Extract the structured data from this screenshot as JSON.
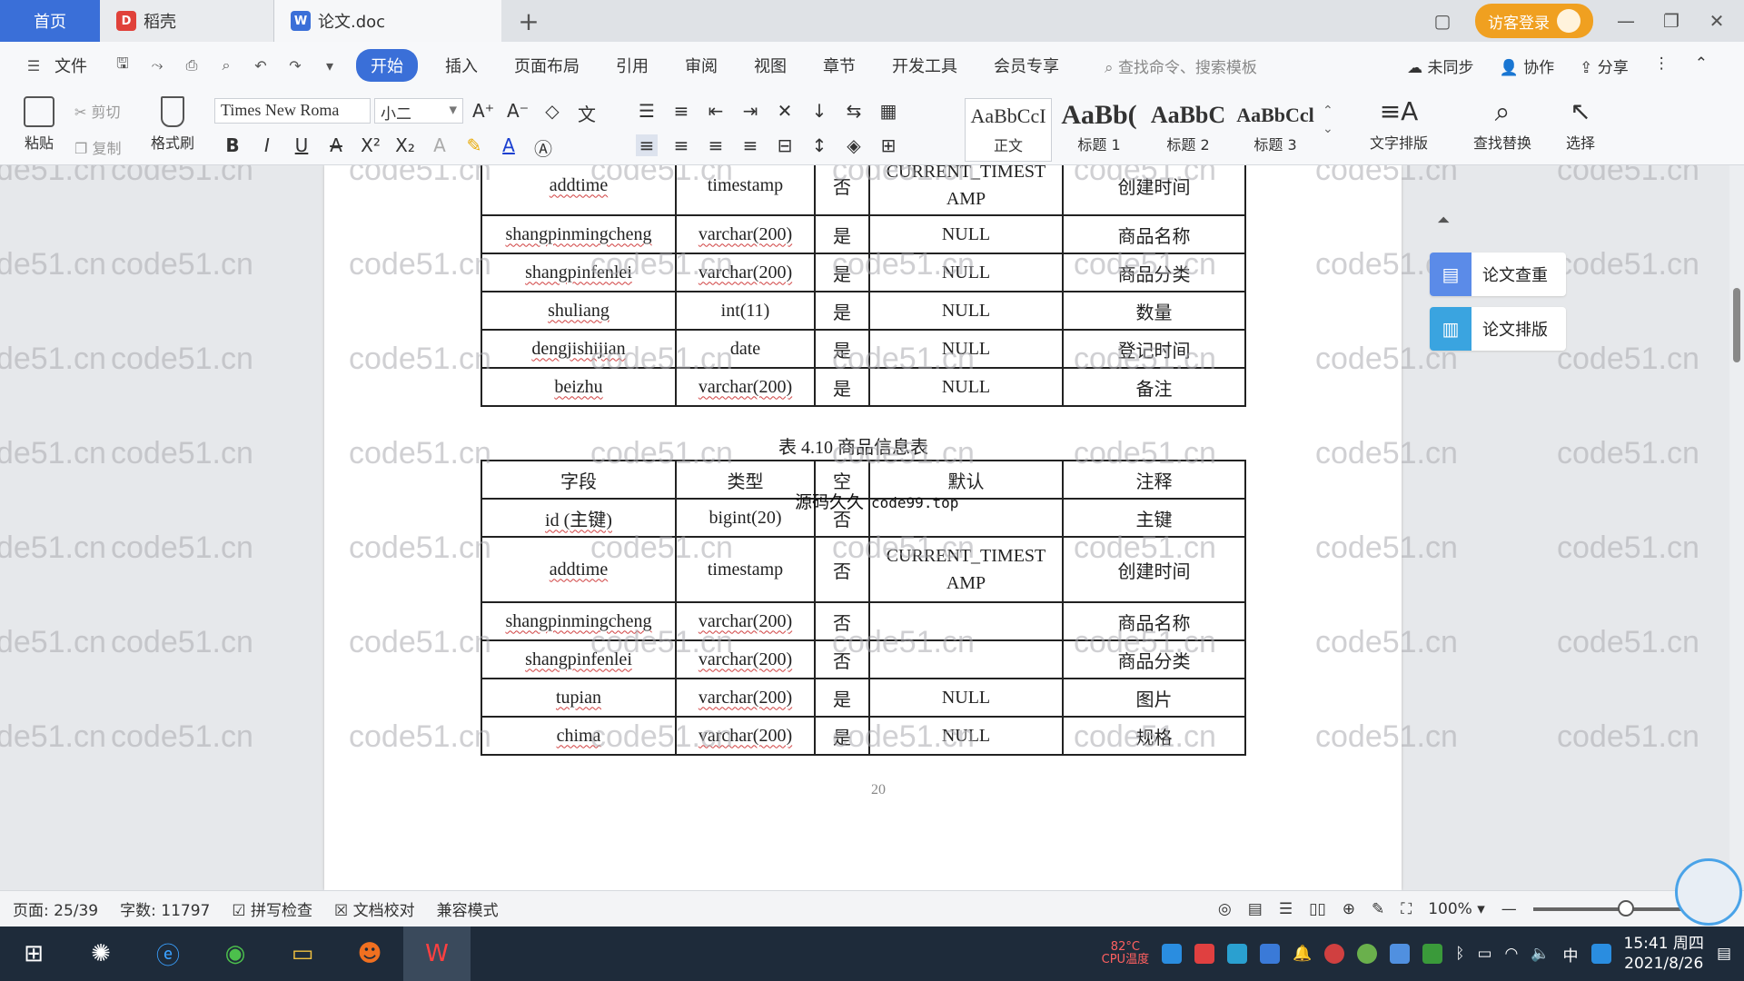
{
  "titlebar": {
    "tabs": [
      {
        "label": "首页"
      },
      {
        "label": "稻壳"
      },
      {
        "label": "论文.doc"
      }
    ],
    "login_label": "访客登录"
  },
  "menu": {
    "file_label": "文件",
    "items": [
      "开始",
      "插入",
      "页面布局",
      "引用",
      "审阅",
      "视图",
      "章节",
      "开发工具",
      "会员专享"
    ],
    "search_label": "查找命令、搜索模板",
    "right": [
      "未同步",
      "协作",
      "分享"
    ]
  },
  "toolbar": {
    "paste": "粘贴",
    "cut": "剪切",
    "copy": "复制",
    "format_painter": "格式刷",
    "font_name": "Times New Roma",
    "font_size": "小二",
    "styles": [
      {
        "sample": "AaBbCcI",
        "label": "正文"
      },
      {
        "sample": "AaBb(",
        "label": "标题 1"
      },
      {
        "sample": "AaBbC",
        "label": "标题 2"
      },
      {
        "sample": "AaBbCcl",
        "label": "标题 3"
      }
    ],
    "text_layout": "文字排版",
    "find_replace": "查找替换",
    "select": "选择"
  },
  "document": {
    "watermark": "code51.cn",
    "table1_rows": [
      [
        "addtime",
        "timestamp",
        "否",
        "CURRENT_TIMESTAMP",
        "创建时间"
      ],
      [
        "shangpinmingcheng",
        "varchar(200)",
        "是",
        "NULL",
        "商品名称"
      ],
      [
        "shangpinfenlei",
        "varchar(200)",
        "是",
        "NULL",
        "商品分类"
      ],
      [
        "shuliang",
        "int(11)",
        "是",
        "NULL",
        "数量"
      ],
      [
        "dengjishijian",
        "date",
        "是",
        "NULL",
        "登记时间"
      ],
      [
        "beizhu",
        "varchar(200)",
        "是",
        "NULL",
        "备注"
      ]
    ],
    "caption": "表 4.10  商品信息表",
    "table2_header": [
      "字段",
      "类型",
      "空",
      "默认",
      "注释"
    ],
    "table2_rows": [
      [
        "id (主键)",
        "bigint(20)",
        "否",
        "",
        "主键"
      ],
      [
        "addtime",
        "timestamp",
        "否",
        "CURRENT_TIMESTAMP",
        "创建时间"
      ],
      [
        "shangpinmingcheng",
        "varchar(200)",
        "否",
        "",
        "商品名称"
      ],
      [
        "shangpinfenlei",
        "varchar(200)",
        "否",
        "",
        "商品分类"
      ],
      [
        "tupian",
        "varchar(200)",
        "是",
        "NULL",
        "图片"
      ],
      [
        "chima",
        "varchar(200)",
        "是",
        "NULL",
        "规格"
      ]
    ],
    "overlay_cn": "源码久久",
    "overlay_url": "code99.top",
    "page_number": "20"
  },
  "side_panel": {
    "check": "论文查重",
    "layout": "论文排版"
  },
  "status": {
    "page": "页面: 25/39",
    "words": "字数: 11797",
    "spell": "拼写检查",
    "proof": "文档校对",
    "compat": "兼容模式",
    "zoom": "100%",
    "zoom_level": 0.6
  },
  "taskbar": {
    "cpu_label": "CPU温度",
    "cpu_value": "82°C",
    "ime": "中",
    "time": "15:41 周四",
    "date": "2021/8/26"
  },
  "colors": {
    "accent": "#3a6fd8",
    "login": "#f0a020",
    "taskbar": "#1e2b3a"
  }
}
